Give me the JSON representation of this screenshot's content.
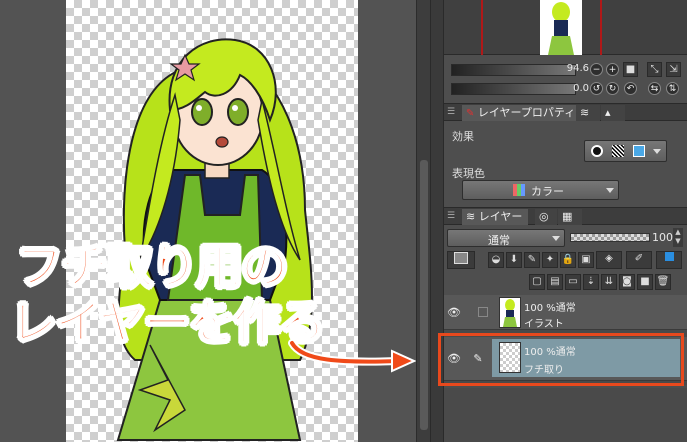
{
  "navigator": {
    "zoom": "94.6",
    "rotation": "0.0"
  },
  "property_panel": {
    "tabs": [
      {
        "label": "レイヤープロパティ"
      }
    ],
    "effect_label": "効果",
    "expression_color_label": "表現色",
    "expression_color_value": "カラー"
  },
  "layer_panel": {
    "tabs": [
      {
        "label": "レイヤー"
      }
    ],
    "blend_mode": "通常",
    "opacity": "100",
    "layers": [
      {
        "info": "100 %通常",
        "name": "イラスト",
        "selected": false
      },
      {
        "info": "100 %通常",
        "name": "フチ取り",
        "selected": true
      }
    ]
  },
  "annotation": {
    "line1": "フチ取り用の",
    "line2": "レイヤーを作る"
  },
  "colors": {
    "accent": "#f04a19",
    "highlight_box": "#e8491d",
    "selected_layer": "#7e9aa5"
  }
}
